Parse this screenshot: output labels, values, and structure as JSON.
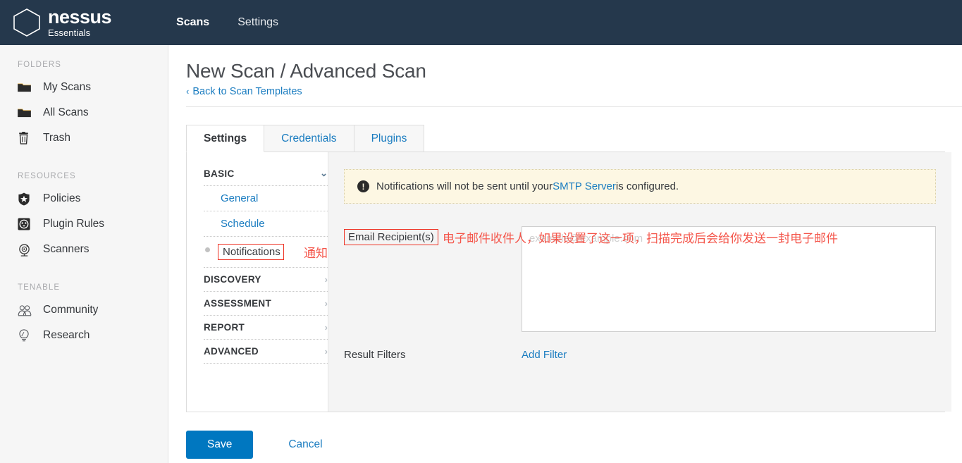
{
  "topbar": {
    "brand_name": "nessus",
    "brand_sub": "Essentials",
    "logo_icon": "hexagon-outline-icon",
    "nav": [
      {
        "label": "Scans",
        "active": true
      },
      {
        "label": "Settings",
        "active": false
      }
    ]
  },
  "sidebar": {
    "groups": [
      {
        "title": "FOLDERS",
        "items": [
          {
            "label": "My Scans",
            "icon": "folder-icon"
          },
          {
            "label": "All Scans",
            "icon": "folder-icon"
          },
          {
            "label": "Trash",
            "icon": "trash-icon"
          }
        ]
      },
      {
        "title": "RESOURCES",
        "items": [
          {
            "label": "Policies",
            "icon": "shield-star-icon"
          },
          {
            "label": "Plugin Rules",
            "icon": "plugin-outlet-icon"
          },
          {
            "label": "Scanners",
            "icon": "radar-icon"
          }
        ]
      },
      {
        "title": "TENABLE",
        "items": [
          {
            "label": "Community",
            "icon": "people-icon"
          },
          {
            "label": "Research",
            "icon": "lightbulb-icon"
          }
        ]
      }
    ]
  },
  "page": {
    "title": "New Scan / Advanced Scan",
    "back_link": "Back to Scan Templates",
    "back_chevron": "‹"
  },
  "tabs": [
    {
      "label": "Settings",
      "active": true
    },
    {
      "label": "Credentials",
      "active": false
    },
    {
      "label": "Plugins",
      "active": false
    }
  ],
  "settings_nav": {
    "rows": [
      {
        "label": "BASIC",
        "type": "section",
        "chevron": "⌄",
        "expanded": true
      },
      {
        "label": "General",
        "type": "sub"
      },
      {
        "label": "Schedule",
        "type": "sub"
      },
      {
        "label": "Notifications",
        "type": "sub",
        "selected": true,
        "annotation": "通知"
      },
      {
        "label": "DISCOVERY",
        "type": "section",
        "chevron": "›"
      },
      {
        "label": "ASSESSMENT",
        "type": "section",
        "chevron": "›"
      },
      {
        "label": "REPORT",
        "type": "section",
        "chevron": "›"
      },
      {
        "label": "ADVANCED",
        "type": "section",
        "chevron": "›"
      }
    ]
  },
  "notice": {
    "icon": "exclamation-circle-icon",
    "icon_glyph": "!",
    "text_before": "Notifications will not be sent until your ",
    "link": "SMTP Server",
    "text_after": " is configured."
  },
  "email_field": {
    "label": "Email Recipient(s)",
    "value": "",
    "placeholder": "example@example.com",
    "annotation": "电子邮件收件人，如果设置了这一项，扫描完成后会给你发送一封电子邮件"
  },
  "result_filters": {
    "label": "Result Filters",
    "add_link": "Add Filter"
  },
  "footer": {
    "save_label": "Save",
    "cancel_label": "Cancel"
  },
  "colors": {
    "topbar": "#25384c",
    "accent_blue": "#0077c0",
    "link_blue": "#1a7cc0",
    "annotation_red": "#f4554a",
    "box_red": "#ee3224",
    "notice_bg": "#fdf7e3",
    "sidebar_bg": "#f6f6f6",
    "content_bg": "#f4f4f4"
  }
}
